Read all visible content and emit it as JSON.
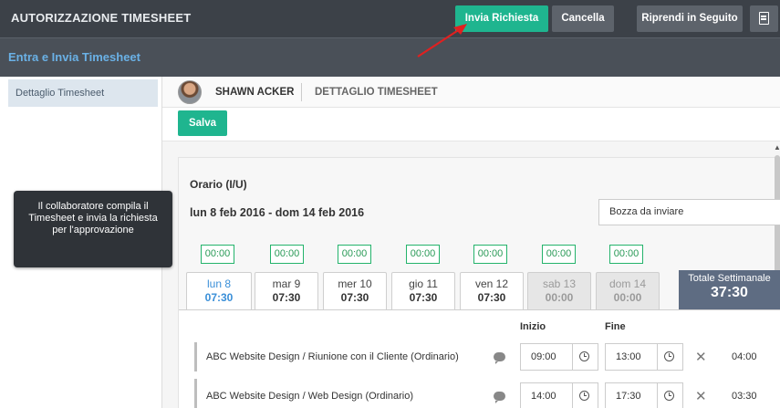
{
  "app": {
    "title": "AUTORIZZAZIONE TIMESHEET"
  },
  "toolbar": {
    "send_label": "Invia Richiesta",
    "cancel_label": "Cancella",
    "resume_label": "Riprendi in Seguito"
  },
  "subheader": {
    "title": "Entra e Invia Timesheet"
  },
  "sidebar": {
    "items": [
      {
        "label": "Dettaglio Timesheet"
      }
    ]
  },
  "tooltip": {
    "text": "Il collaboratore compila il Timesheet e invia la richiesta per l'approvazione"
  },
  "person": {
    "name": "SHAWN ACKER",
    "tab": "DETTAGLIO TIMESHEET"
  },
  "actions": {
    "save_label": "Salva"
  },
  "timesheet": {
    "section_title": "Orario (I/U)",
    "date_range": "lun 8 feb 2016 - dom 14 feb 2016",
    "status": "Bozza da inviare",
    "day_totals": [
      "00:00",
      "00:00",
      "00:00",
      "00:00",
      "00:00",
      "00:00",
      "00:00"
    ],
    "days": [
      {
        "name": "lun 8",
        "hours": "07:30"
      },
      {
        "name": "mar 9",
        "hours": "07:30"
      },
      {
        "name": "mer 10",
        "hours": "07:30"
      },
      {
        "name": "gio 11",
        "hours": "07:30"
      },
      {
        "name": "ven 12",
        "hours": "07:30"
      },
      {
        "name": "sab 13",
        "hours": "00:00"
      },
      {
        "name": "dom 14",
        "hours": "00:00"
      }
    ],
    "weekly_total_label": "Totale Settimanale",
    "weekly_total_value": "37:30",
    "col_start": "Inizio",
    "col_end": "Fine",
    "entries": [
      {
        "label": "ABC Website Design / Riunione con il Cliente (Ordinario)",
        "start": "09:00",
        "end": "13:00",
        "duration": "04:00"
      },
      {
        "label": "ABC Website Design / Web Design (Ordinario)",
        "start": "14:00",
        "end": "17:30",
        "duration": "03:30"
      }
    ]
  },
  "colors": {
    "accent": "#1fb58f",
    "topbar": "#3c4148",
    "arrow": "#e02020",
    "active_day": "#3a8fd8"
  }
}
